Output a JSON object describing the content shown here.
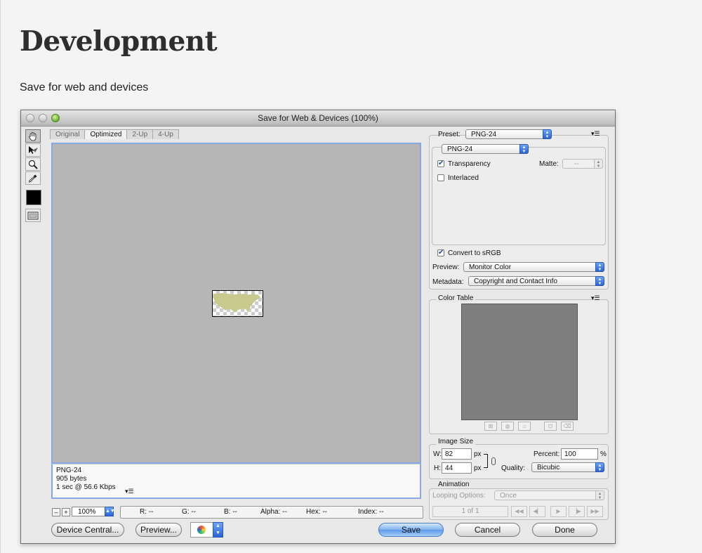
{
  "page": {
    "title": "Development",
    "subtitle": "Save for web and devices"
  },
  "dialog": {
    "title": "Save for Web & Devices (100%)",
    "tabs": [
      "Original",
      "Optimized",
      "2-Up",
      "4-Up"
    ],
    "active_tab": "Optimized",
    "tools": [
      "hand-icon",
      "slice-select-icon",
      "zoom-icon",
      "eyedropper-icon",
      "eyedropper-color-swatch",
      "toggle-slices-icon"
    ],
    "status": {
      "format": "PNG-24",
      "size": "905 bytes",
      "speed": "1 sec @ 56.6 Kbps"
    },
    "zoom": {
      "minus": "–",
      "plus": "+",
      "level": "100%"
    },
    "readout": {
      "r": "R: --",
      "g": "G: --",
      "b": "B: --",
      "alpha": "Alpha: --",
      "hex": "Hex: --",
      "index": "Index: --"
    },
    "buttons": {
      "device_central": "Device Central...",
      "preview": "Preview...",
      "save": "Save",
      "cancel": "Cancel",
      "done": "Done"
    },
    "settings": {
      "preset_label": "Preset:",
      "preset_value": "PNG-24",
      "format_value": "PNG-24",
      "transparency_label": "Transparency",
      "transparency_checked": true,
      "matte_label": "Matte:",
      "matte_value": "--",
      "interlaced_label": "Interlaced",
      "interlaced_checked": false,
      "convert_label": "Convert to sRGB",
      "convert_checked": true,
      "preview_label": "Preview:",
      "preview_value": "Monitor Color",
      "metadata_label": "Metadata:",
      "metadata_value": "Copyright and Contact Info"
    },
    "color_table": {
      "title": "Color Table",
      "tile_color": "#7f7f7f"
    },
    "image_size": {
      "title": "Image Size",
      "w_label": "W:",
      "w_value": "82",
      "h_label": "H:",
      "h_value": "44",
      "unit": "px",
      "percent_label": "Percent:",
      "percent_value": "100",
      "percent_unit": "%",
      "quality_label": "Quality:",
      "quality_value": "Bicubic"
    },
    "animation": {
      "title": "Animation",
      "looping_label": "Looping Options:",
      "looping_value": "Once",
      "frame_counter": "1 of 1"
    }
  },
  "colors": {
    "accent_blue": "#2a63d6",
    "canvas_gray": "#b6b6b6",
    "focus_ring": "#86a9e2",
    "map_fill": "#c8ca8d"
  }
}
